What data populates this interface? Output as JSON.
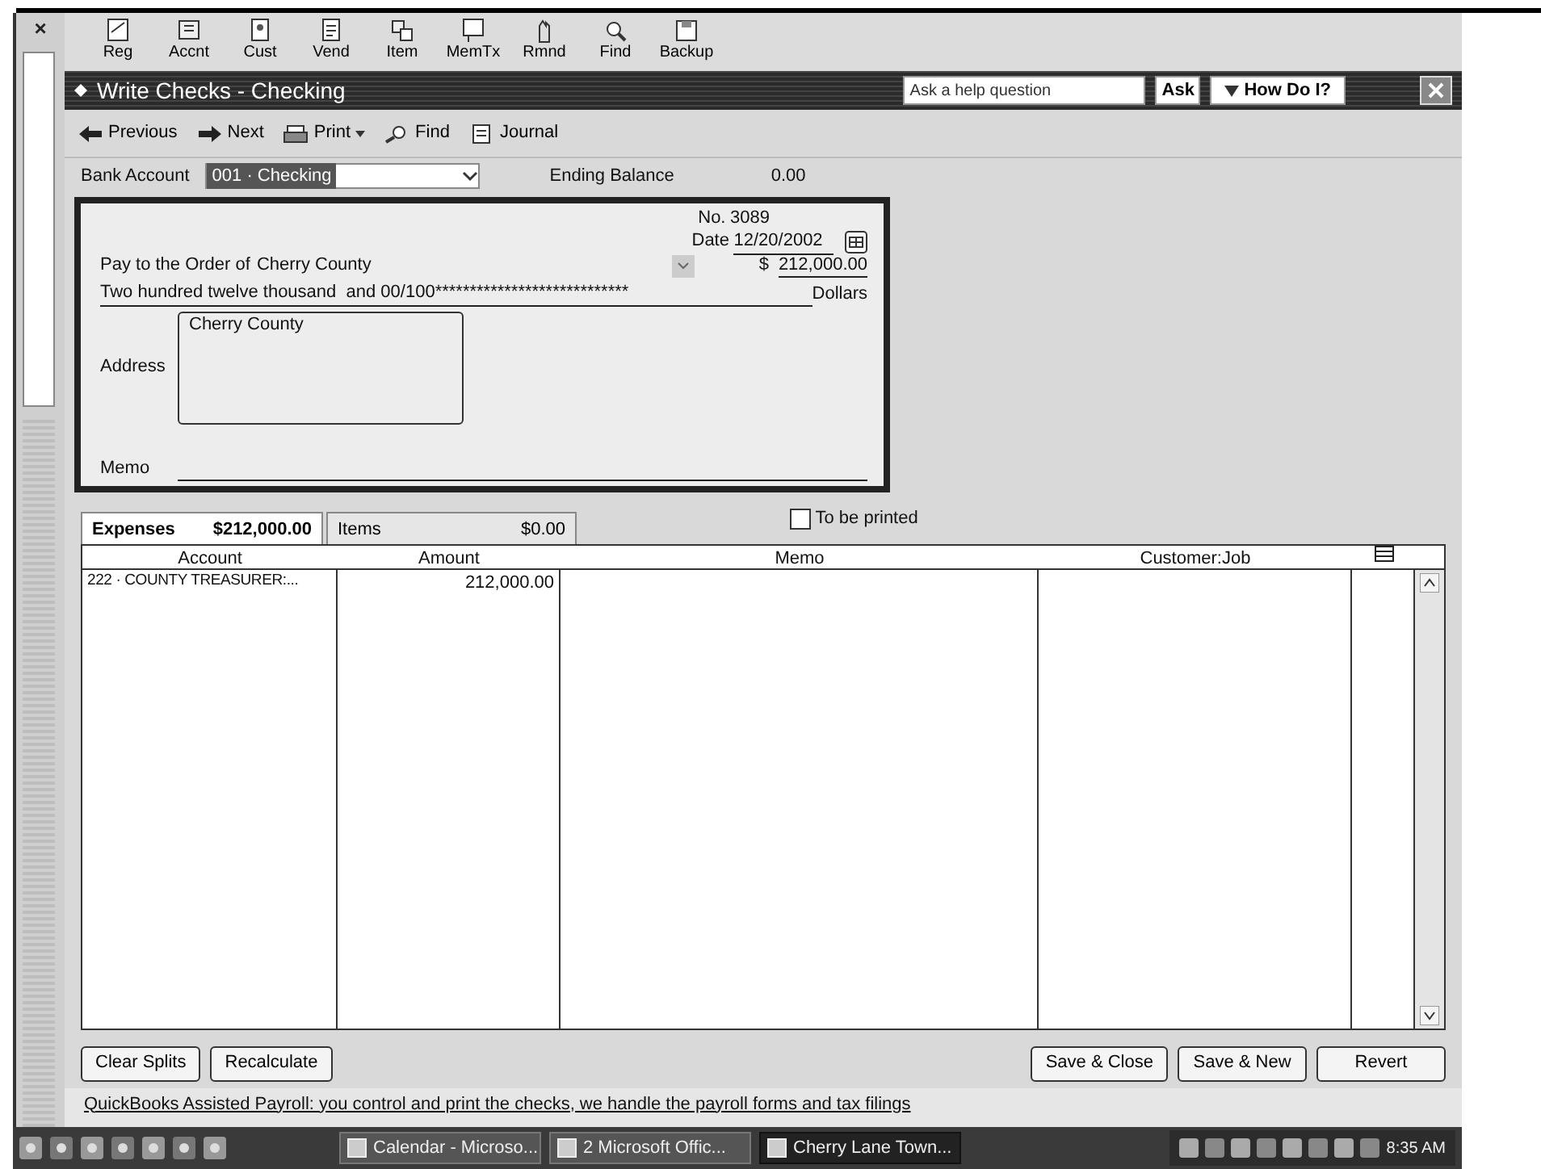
{
  "icon_bar": [
    {
      "label": "Reg"
    },
    {
      "label": "Accnt"
    },
    {
      "label": "Cust"
    },
    {
      "label": "Vend"
    },
    {
      "label": "Item"
    },
    {
      "label": "MemTx"
    },
    {
      "label": "Rmnd"
    },
    {
      "label": "Find"
    },
    {
      "label": "Backup"
    }
  ],
  "sidebar": {
    "close": "×"
  },
  "window": {
    "title": "Write Checks - Checking",
    "help_field": {
      "placeholder": "Ask a help question"
    },
    "ask_button": "Ask",
    "how_do_i": "How Do I?"
  },
  "toolbar": [
    {
      "label": "Previous",
      "kind": "previous"
    },
    {
      "label": "Next",
      "kind": "next"
    },
    {
      "label": "Print",
      "kind": "print"
    },
    {
      "label": "Find",
      "kind": "find"
    },
    {
      "label": "Journal",
      "kind": "journal"
    }
  ],
  "bank_account": {
    "label": "Bank Account",
    "value": "001 · Checking"
  },
  "ending_balance": {
    "label": "Ending Balance",
    "value": "0.00"
  },
  "check": {
    "no_label": "No.",
    "number": "3089",
    "date_label": "Date",
    "date": "12/20/2002",
    "pay_label": "Pay to the Order of",
    "payee": "Cherry County",
    "dollar_sign": "$",
    "amount": "212,000.00",
    "amount_words": "Two hundred twelve thousand  and 00/100****************************",
    "dollars_label": "Dollars",
    "address_label": "Address",
    "address": "Cherry County",
    "memo_label": "Memo"
  },
  "tabs": [
    {
      "label": "Expenses",
      "amount": "$212,000.00",
      "selected": true
    },
    {
      "label": "Items",
      "amount": "$0.00",
      "selected": false
    }
  ],
  "to_be_printed": {
    "label": "To be printed",
    "checked": false
  },
  "table": {
    "columns": [
      "Account",
      "Amount",
      "Memo",
      "Customer:Job"
    ],
    "rows": [
      {
        "account": "222 · COUNTY TREASURER:...",
        "amount": "212,000.00"
      }
    ]
  },
  "buttons_left": [
    "Clear Splits",
    "Recalculate"
  ],
  "buttons_right": [
    "Save & Close",
    "Save & New",
    "Revert"
  ],
  "footer_link": "QuickBooks Assisted Payroll: you control and print the checks, we handle the payroll forms and tax filings",
  "taskbar": {
    "tasks": [
      {
        "label": "Calendar - Microso...",
        "selected": false
      },
      {
        "label": "2 Microsoft Offic...",
        "selected": false
      },
      {
        "label": "Cherry Lane Town...",
        "selected": true
      }
    ],
    "clock": "8:35 AM"
  }
}
